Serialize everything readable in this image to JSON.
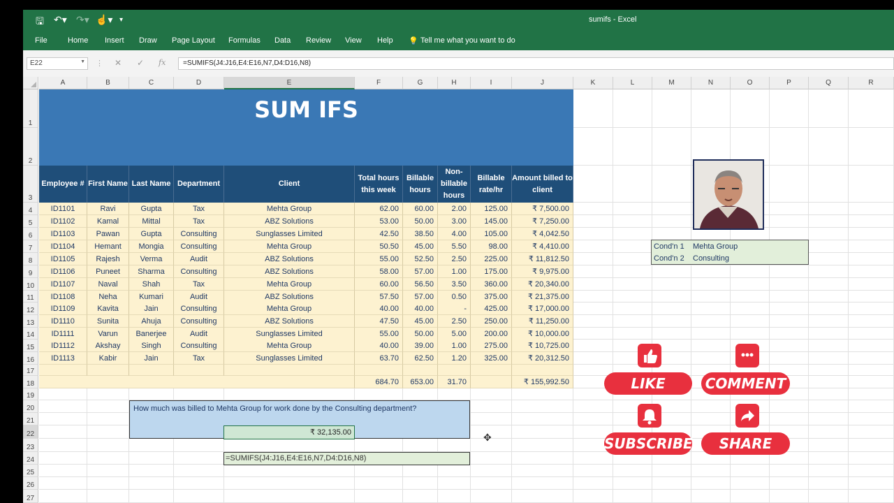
{
  "window": {
    "title": "sumifs  -  Excel"
  },
  "menu": [
    "File",
    "Home",
    "Insert",
    "Draw",
    "Page Layout",
    "Formulas",
    "Data",
    "Review",
    "View",
    "Help"
  ],
  "tell_me": "Tell me what you want to do",
  "formula_bar": {
    "name_box": "E22",
    "cancel": "✕",
    "enter": "✓",
    "fx": "fx",
    "formula": "=SUMIFS(J4:J16,E4:E16,N7,D4:D16,N8)"
  },
  "columns": [
    "A",
    "B",
    "C",
    "D",
    "E",
    "F",
    "G",
    "H",
    "I",
    "J",
    "K",
    "L",
    "M",
    "N",
    "O",
    "P",
    "Q",
    "R"
  ],
  "rows": [
    "1",
    "2",
    "3",
    "4",
    "5",
    "6",
    "7",
    "8",
    "9",
    "10",
    "11",
    "12",
    "13",
    "14",
    "15",
    "16",
    "17",
    "18",
    "19",
    "20",
    "21",
    "22",
    "23",
    "24",
    "25",
    "26",
    "27"
  ],
  "sheet": {
    "title": "SUM IFS",
    "headers": [
      "Employee #",
      "First Name",
      "Last Name",
      "Department",
      "Client",
      "Total hours this week",
      "Billable hours",
      "Non-billable hours",
      "Billable rate/hr",
      "Amount billed to client"
    ],
    "data": [
      [
        "ID1101",
        "Ravi",
        "Gupta",
        "Tax",
        "Mehta Group",
        "62.00",
        "60.00",
        "2.00",
        "125.00",
        "₹ 7,500.00"
      ],
      [
        "ID1102",
        "Kamal",
        "Mittal",
        "Tax",
        "ABZ Solutions",
        "53.00",
        "50.00",
        "3.00",
        "145.00",
        "₹ 7,250.00"
      ],
      [
        "ID1103",
        "Pawan",
        "Gupta",
        "Consulting",
        "Sunglasses Limited",
        "42.50",
        "38.50",
        "4.00",
        "105.00",
        "₹ 4,042.50"
      ],
      [
        "ID1104",
        "Hemant",
        "Mongia",
        "Consulting",
        "Mehta Group",
        "50.50",
        "45.00",
        "5.50",
        "98.00",
        "₹ 4,410.00"
      ],
      [
        "ID1105",
        "Rajesh",
        "Verma",
        "Audit",
        "ABZ Solutions",
        "55.00",
        "52.50",
        "2.50",
        "225.00",
        "₹ 11,812.50"
      ],
      [
        "ID1106",
        "Puneet",
        "Sharma",
        "Consulting",
        "ABZ Solutions",
        "58.00",
        "57.00",
        "1.00",
        "175.00",
        "₹ 9,975.00"
      ],
      [
        "ID1107",
        "Naval",
        "Shah",
        "Tax",
        "Mehta Group",
        "60.00",
        "56.50",
        "3.50",
        "360.00",
        "₹ 20,340.00"
      ],
      [
        "ID1108",
        "Neha",
        "Kumari",
        "Audit",
        "ABZ Solutions",
        "57.50",
        "57.00",
        "0.50",
        "375.00",
        "₹ 21,375.00"
      ],
      [
        "ID1109",
        "Kavita",
        "Jain",
        "Consulting",
        "Mehta Group",
        "40.00",
        "40.00",
        "-",
        "425.00",
        "₹ 17,000.00"
      ],
      [
        "ID1110",
        "Sunita",
        "Ahuja",
        "Consulting",
        "ABZ Solutions",
        "47.50",
        "45.00",
        "2.50",
        "250.00",
        "₹ 11,250.00"
      ],
      [
        "ID1111",
        "Varun",
        "Banerjee",
        "Audit",
        "Sunglasses Limited",
        "55.00",
        "50.00",
        "5.00",
        "200.00",
        "₹ 10,000.00"
      ],
      [
        "ID1112",
        "Akshay",
        "Singh",
        "Consulting",
        "Mehta Group",
        "40.00",
        "39.00",
        "1.00",
        "275.00",
        "₹ 10,725.00"
      ],
      [
        "ID1113",
        "Kabir",
        "Jain",
        "Tax",
        "Sunglasses Limited",
        "63.70",
        "62.50",
        "1.20",
        "325.00",
        "₹ 20,312.50"
      ]
    ],
    "totals": [
      "684.70",
      "653.00",
      "31.70",
      "",
      "₹ 155,992.50"
    ],
    "question": "How much was billed to Mehta Group for work done by the Consulting department?",
    "result": "₹ 32,135.00",
    "formula_shown": "=SUMIFS(J4:J16,E4:E16,N7,D4:D16,N8)",
    "conditions": [
      {
        "label": "Cond'n 1",
        "value": "Mehta Group"
      },
      {
        "label": "Cond'n 2",
        "value": "Consulting"
      }
    ]
  },
  "social": {
    "like": "LIKE",
    "comment": "COMMENT",
    "subscribe": "SUBSCRIBE",
    "share": "SHARE"
  },
  "colors": {
    "excel_green": "#217346",
    "title_blue": "#3a78b5",
    "header_navy": "#1f4e79",
    "data_fill": "#fdf2d0",
    "social_red": "#e8303e"
  }
}
